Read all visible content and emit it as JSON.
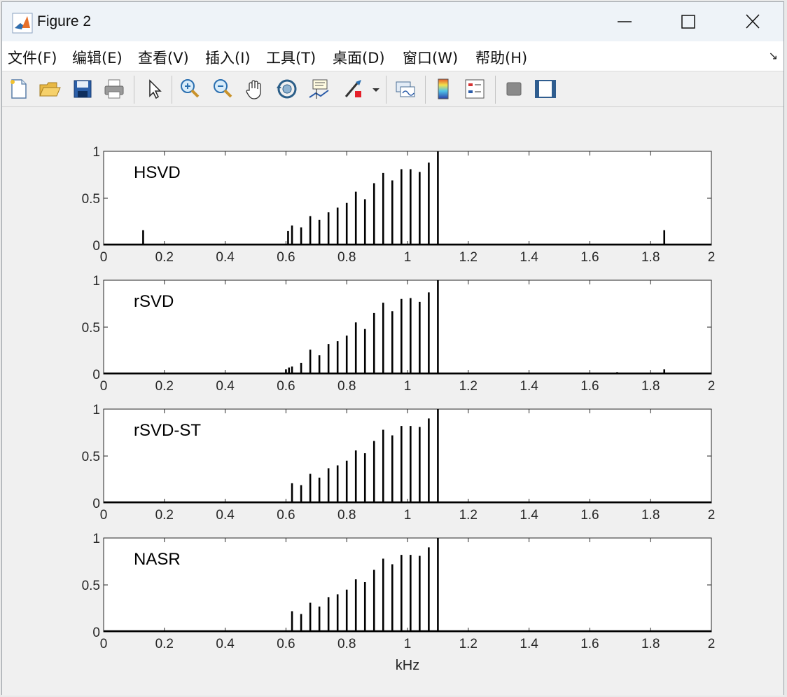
{
  "window": {
    "title": "Figure 2",
    "icon": "matlab-icon",
    "controls": [
      "minimize-icon",
      "maximize-icon",
      "close-icon"
    ]
  },
  "menu": {
    "items": [
      {
        "label": "文件(F)",
        "name": "menu-file"
      },
      {
        "label": "编辑(E)",
        "name": "menu-edit"
      },
      {
        "label": "查看(V)",
        "name": "menu-view"
      },
      {
        "label": "插入(I)",
        "name": "menu-insert"
      },
      {
        "label": "工具(T)",
        "name": "menu-tools"
      },
      {
        "label": "桌面(D)",
        "name": "menu-desktop"
      },
      {
        "label": "窗口(W)",
        "name": "menu-window"
      },
      {
        "label": "帮助(H)",
        "name": "menu-help"
      }
    ],
    "dock_arrow": "↘"
  },
  "toolbar": {
    "buttons": [
      "new-figure-icon",
      "open-file-icon",
      "save-icon",
      "print-icon",
      "select-pointer-icon",
      "zoom-in-icon",
      "zoom-out-icon",
      "pan-hand-icon",
      "rotate-3d-icon",
      "data-cursor-icon",
      "brush-icon",
      "link-plot-icon",
      "colorbar-icon",
      "legend-icon",
      "hide-plot-tools-icon",
      "show-plot-tools-icon"
    ]
  },
  "colors": {
    "line": "#000000",
    "axes_bg": "#ffffff",
    "figure_bg": "#f0f0f0"
  },
  "chart_data": [
    {
      "type": "line",
      "label": "HSVD",
      "xlabel": "",
      "xlim": [
        0,
        2
      ],
      "ylim": [
        0,
        1
      ],
      "xticks": [
        0,
        0.2,
        0.4,
        0.6,
        0.8,
        1,
        1.2,
        1.4,
        1.6,
        1.8,
        2
      ],
      "xtick_labels": [
        "0",
        "0.2",
        "0.4",
        "0.6",
        "0.8",
        "1",
        "1.2",
        "1.4",
        "1.6",
        "1.8",
        "2"
      ],
      "yticks": [
        0,
        0.5,
        1
      ],
      "ytick_labels": [
        "0",
        "0.5",
        "1"
      ],
      "peaks": [
        [
          0.13,
          0.16
        ],
        [
          0.607,
          0.15
        ],
        [
          0.62,
          0.21
        ],
        [
          0.65,
          0.19
        ],
        [
          0.68,
          0.31
        ],
        [
          0.71,
          0.27
        ],
        [
          0.74,
          0.35
        ],
        [
          0.77,
          0.4
        ],
        [
          0.8,
          0.45
        ],
        [
          0.83,
          0.57
        ],
        [
          0.86,
          0.49
        ],
        [
          0.89,
          0.66
        ],
        [
          0.92,
          0.77
        ],
        [
          0.95,
          0.69
        ],
        [
          0.98,
          0.81
        ],
        [
          1.01,
          0.81
        ],
        [
          1.04,
          0.78
        ],
        [
          1.07,
          0.88
        ],
        [
          1.1,
          1.0
        ],
        [
          1.845,
          0.16
        ]
      ]
    },
    {
      "type": "line",
      "label": "rSVD",
      "xlabel": "",
      "xlim": [
        0,
        2
      ],
      "ylim": [
        0,
        1
      ],
      "xticks": [
        0,
        0.2,
        0.4,
        0.6,
        0.8,
        1,
        1.2,
        1.4,
        1.6,
        1.8,
        2
      ],
      "xtick_labels": [
        "0",
        "0.2",
        "0.4",
        "0.6",
        "0.8",
        "1",
        "1.2",
        "1.4",
        "1.6",
        "1.8",
        "2"
      ],
      "yticks": [
        0,
        0.5,
        1
      ],
      "ytick_labels": [
        "0",
        "0.5",
        "1"
      ],
      "peaks": [
        [
          0.13,
          0.01
        ],
        [
          0.6,
          0.05
        ],
        [
          0.61,
          0.07
        ],
        [
          0.62,
          0.08
        ],
        [
          0.65,
          0.12
        ],
        [
          0.68,
          0.26
        ],
        [
          0.71,
          0.2
        ],
        [
          0.74,
          0.32
        ],
        [
          0.77,
          0.35
        ],
        [
          0.8,
          0.41
        ],
        [
          0.83,
          0.55
        ],
        [
          0.86,
          0.48
        ],
        [
          0.89,
          0.65
        ],
        [
          0.92,
          0.76
        ],
        [
          0.95,
          0.67
        ],
        [
          0.98,
          0.8
        ],
        [
          1.01,
          0.81
        ],
        [
          1.04,
          0.77
        ],
        [
          1.07,
          0.87
        ],
        [
          1.1,
          1.0
        ],
        [
          1.69,
          0.02
        ],
        [
          1.845,
          0.05
        ]
      ]
    },
    {
      "type": "line",
      "label": "rSVD-ST",
      "xlabel": "",
      "xlim": [
        0,
        2
      ],
      "ylim": [
        0,
        1
      ],
      "xticks": [
        0,
        0.2,
        0.4,
        0.6,
        0.8,
        1,
        1.2,
        1.4,
        1.6,
        1.8,
        2
      ],
      "xtick_labels": [
        "0",
        "0.2",
        "0.4",
        "0.6",
        "0.8",
        "1",
        "1.2",
        "1.4",
        "1.6",
        "1.8",
        "2"
      ],
      "yticks": [
        0,
        0.5,
        1
      ],
      "ytick_labels": [
        "0",
        "0.5",
        "1"
      ],
      "peaks": [
        [
          0.62,
          0.21
        ],
        [
          0.65,
          0.19
        ],
        [
          0.68,
          0.31
        ],
        [
          0.71,
          0.27
        ],
        [
          0.74,
          0.37
        ],
        [
          0.77,
          0.4
        ],
        [
          0.8,
          0.45
        ],
        [
          0.83,
          0.56
        ],
        [
          0.86,
          0.53
        ],
        [
          0.89,
          0.66
        ],
        [
          0.92,
          0.78
        ],
        [
          0.95,
          0.72
        ],
        [
          0.98,
          0.82
        ],
        [
          1.01,
          0.82
        ],
        [
          1.04,
          0.81
        ],
        [
          1.07,
          0.9
        ],
        [
          1.1,
          1.0
        ]
      ]
    },
    {
      "type": "line",
      "label": "NASR",
      "xlabel": "kHz",
      "xlim": [
        0,
        2
      ],
      "ylim": [
        0,
        1
      ],
      "xticks": [
        0,
        0.2,
        0.4,
        0.6,
        0.8,
        1,
        1.2,
        1.4,
        1.6,
        1.8,
        2
      ],
      "xtick_labels": [
        "0",
        "0.2",
        "0.4",
        "0.6",
        "0.8",
        "1",
        "1.2",
        "1.4",
        "1.6",
        "1.8",
        "2"
      ],
      "yticks": [
        0,
        0.5,
        1
      ],
      "ytick_labels": [
        "0",
        "0.5",
        "1"
      ],
      "peaks": [
        [
          0.62,
          0.22
        ],
        [
          0.65,
          0.19
        ],
        [
          0.68,
          0.31
        ],
        [
          0.71,
          0.27
        ],
        [
          0.74,
          0.37
        ],
        [
          0.77,
          0.4
        ],
        [
          0.8,
          0.45
        ],
        [
          0.83,
          0.56
        ],
        [
          0.86,
          0.53
        ],
        [
          0.89,
          0.66
        ],
        [
          0.92,
          0.78
        ],
        [
          0.95,
          0.72
        ],
        [
          0.98,
          0.82
        ],
        [
          1.01,
          0.82
        ],
        [
          1.04,
          0.81
        ],
        [
          1.07,
          0.9
        ],
        [
          1.1,
          1.0
        ]
      ]
    }
  ]
}
